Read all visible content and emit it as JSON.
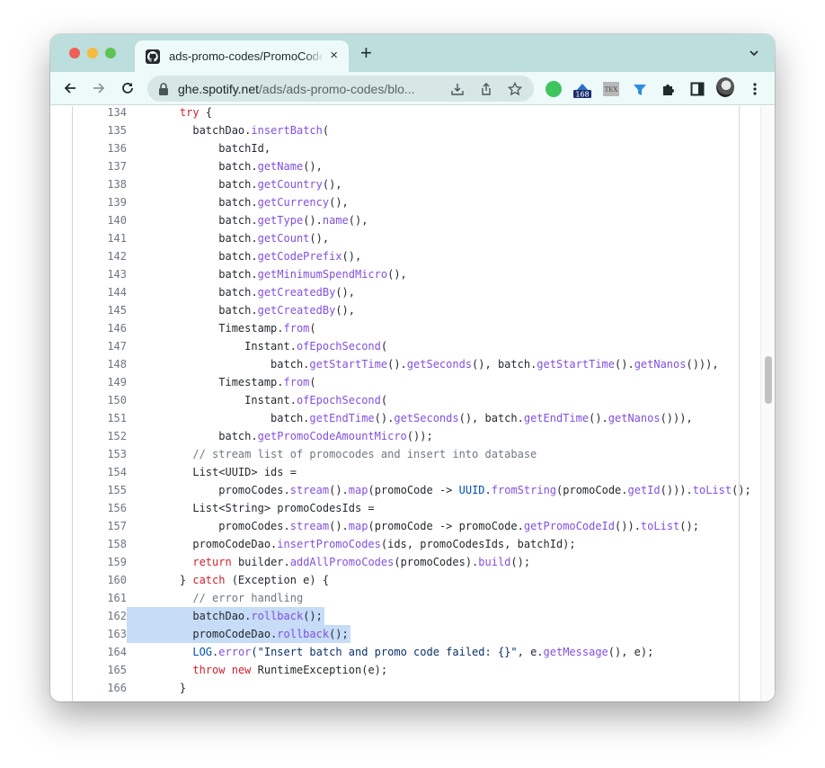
{
  "browser": {
    "tab_title": "ads-promo-codes/PromoCodeService.java",
    "tab_close": "×",
    "new_tab": "+",
    "url_host": "ghe.spotify.net",
    "url_path": "/ads/ads-promo-codes/blo...",
    "extension_badge": "168",
    "tex_label": "TEX"
  },
  "colors": {
    "tab_strip": "#bcdedc",
    "toolbar": "#eefafa",
    "keyword": "#cf222e",
    "function": "#8250df",
    "comment": "#6e7781",
    "selection": "#c6dcf7"
  },
  "code": {
    "lines": [
      {
        "n": "134",
        "indent": 2,
        "tokens": [
          [
            "k",
            "try"
          ],
          [
            "p",
            " {"
          ]
        ]
      },
      {
        "n": "135",
        "indent": 3,
        "tokens": [
          [
            "p",
            "batchDao."
          ],
          [
            "f",
            "insertBatch"
          ],
          [
            "p",
            "("
          ]
        ]
      },
      {
        "n": "136",
        "indent": 5,
        "tokens": [
          [
            "p",
            "batchId,"
          ]
        ]
      },
      {
        "n": "137",
        "indent": 5,
        "tokens": [
          [
            "p",
            "batch."
          ],
          [
            "f",
            "getName"
          ],
          [
            "p",
            "(),"
          ]
        ]
      },
      {
        "n": "138",
        "indent": 5,
        "tokens": [
          [
            "p",
            "batch."
          ],
          [
            "f",
            "getCountry"
          ],
          [
            "p",
            "(),"
          ]
        ]
      },
      {
        "n": "139",
        "indent": 5,
        "tokens": [
          [
            "p",
            "batch."
          ],
          [
            "f",
            "getCurrency"
          ],
          [
            "p",
            "(),"
          ]
        ]
      },
      {
        "n": "140",
        "indent": 5,
        "tokens": [
          [
            "p",
            "batch."
          ],
          [
            "f",
            "getType"
          ],
          [
            "p",
            "()."
          ],
          [
            "f",
            "name"
          ],
          [
            "p",
            "(),"
          ]
        ]
      },
      {
        "n": "141",
        "indent": 5,
        "tokens": [
          [
            "p",
            "batch."
          ],
          [
            "f",
            "getCount"
          ],
          [
            "p",
            "(),"
          ]
        ]
      },
      {
        "n": "142",
        "indent": 5,
        "tokens": [
          [
            "p",
            "batch."
          ],
          [
            "f",
            "getCodePrefix"
          ],
          [
            "p",
            "(),"
          ]
        ]
      },
      {
        "n": "143",
        "indent": 5,
        "tokens": [
          [
            "p",
            "batch."
          ],
          [
            "f",
            "getMinimumSpendMicro"
          ],
          [
            "p",
            "(),"
          ]
        ]
      },
      {
        "n": "144",
        "indent": 5,
        "tokens": [
          [
            "p",
            "batch."
          ],
          [
            "f",
            "getCreatedBy"
          ],
          [
            "p",
            "(),"
          ]
        ]
      },
      {
        "n": "145",
        "indent": 5,
        "tokens": [
          [
            "p",
            "batch."
          ],
          [
            "f",
            "getCreatedBy"
          ],
          [
            "p",
            "(),"
          ]
        ]
      },
      {
        "n": "146",
        "indent": 5,
        "tokens": [
          [
            "p",
            "Timestamp."
          ],
          [
            "f",
            "from"
          ],
          [
            "p",
            "("
          ]
        ]
      },
      {
        "n": "147",
        "indent": 7,
        "tokens": [
          [
            "p",
            "Instant."
          ],
          [
            "f",
            "ofEpochSecond"
          ],
          [
            "p",
            "("
          ]
        ]
      },
      {
        "n": "148",
        "indent": 9,
        "tokens": [
          [
            "p",
            "batch."
          ],
          [
            "f",
            "getStartTime"
          ],
          [
            "p",
            "()."
          ],
          [
            "f",
            "getSeconds"
          ],
          [
            "p",
            "(), batch."
          ],
          [
            "f",
            "getStartTime"
          ],
          [
            "p",
            "()."
          ],
          [
            "f",
            "getNanos"
          ],
          [
            "p",
            "())),"
          ]
        ]
      },
      {
        "n": "149",
        "indent": 5,
        "tokens": [
          [
            "p",
            "Timestamp."
          ],
          [
            "f",
            "from"
          ],
          [
            "p",
            "("
          ]
        ]
      },
      {
        "n": "150",
        "indent": 7,
        "tokens": [
          [
            "p",
            "Instant."
          ],
          [
            "f",
            "ofEpochSecond"
          ],
          [
            "p",
            "("
          ]
        ]
      },
      {
        "n": "151",
        "indent": 9,
        "tokens": [
          [
            "p",
            "batch."
          ],
          [
            "f",
            "getEndTime"
          ],
          [
            "p",
            "()."
          ],
          [
            "f",
            "getSeconds"
          ],
          [
            "p",
            "(), batch."
          ],
          [
            "f",
            "getEndTime"
          ],
          [
            "p",
            "()."
          ],
          [
            "f",
            "getNanos"
          ],
          [
            "p",
            "())),"
          ]
        ]
      },
      {
        "n": "152",
        "indent": 5,
        "tokens": [
          [
            "p",
            "batch."
          ],
          [
            "f",
            "getPromoCodeAmountMicro"
          ],
          [
            "p",
            "());"
          ]
        ]
      },
      {
        "n": "153",
        "indent": 3,
        "tokens": [
          [
            "c",
            "// stream list of promocodes and insert into database"
          ]
        ]
      },
      {
        "n": "154",
        "indent": 3,
        "tokens": [
          [
            "p",
            "List<UUID> ids ="
          ]
        ]
      },
      {
        "n": "155",
        "indent": 5,
        "tokens": [
          [
            "p",
            "promoCodes."
          ],
          [
            "f",
            "stream"
          ],
          [
            "p",
            "()."
          ],
          [
            "f",
            "map"
          ],
          [
            "p",
            "(promoCode -> "
          ],
          [
            "t",
            "UUID"
          ],
          [
            "p",
            "."
          ],
          [
            "f",
            "fromString"
          ],
          [
            "p",
            "(promoCode."
          ],
          [
            "f",
            "getId"
          ],
          [
            "p",
            "()))."
          ],
          [
            "f",
            "toList"
          ],
          [
            "p",
            "();"
          ]
        ]
      },
      {
        "n": "156",
        "indent": 3,
        "tokens": [
          [
            "p",
            "List<String> promoCodesIds ="
          ]
        ]
      },
      {
        "n": "157",
        "indent": 5,
        "tokens": [
          [
            "p",
            "promoCodes."
          ],
          [
            "f",
            "stream"
          ],
          [
            "p",
            "()."
          ],
          [
            "f",
            "map"
          ],
          [
            "p",
            "(promoCode -> promoCode."
          ],
          [
            "f",
            "getPromoCodeId"
          ],
          [
            "p",
            "())."
          ],
          [
            "f",
            "toList"
          ],
          [
            "p",
            "();"
          ]
        ]
      },
      {
        "n": "158",
        "indent": 3,
        "tokens": [
          [
            "p",
            "promoCodeDao."
          ],
          [
            "f",
            "insertPromoCodes"
          ],
          [
            "p",
            "(ids, promoCodesIds, batchId);"
          ]
        ]
      },
      {
        "n": "159",
        "indent": 3,
        "tokens": [
          [
            "k",
            "return"
          ],
          [
            "p",
            " builder."
          ],
          [
            "f",
            "addAllPromoCodes"
          ],
          [
            "p",
            "(promoCodes)."
          ],
          [
            "f",
            "build"
          ],
          [
            "p",
            "();"
          ]
        ]
      },
      {
        "n": "160",
        "indent": 2,
        "tokens": [
          [
            "p",
            "} "
          ],
          [
            "k",
            "catch"
          ],
          [
            "p",
            " (Exception e) {"
          ]
        ]
      },
      {
        "n": "161",
        "indent": 3,
        "tokens": [
          [
            "c",
            "// error handling"
          ]
        ]
      },
      {
        "n": "162",
        "indent": 3,
        "highlight": true,
        "tokens": [
          [
            "p",
            "batchDao."
          ],
          [
            "f",
            "rollback"
          ],
          [
            "p",
            "();"
          ]
        ]
      },
      {
        "n": "163",
        "indent": 3,
        "highlight": true,
        "tokens": [
          [
            "p",
            "promoCodeDao."
          ],
          [
            "f",
            "rollback"
          ],
          [
            "p",
            "();"
          ]
        ]
      },
      {
        "n": "164",
        "indent": 3,
        "tokens": [
          [
            "t",
            "LOG"
          ],
          [
            "p",
            "."
          ],
          [
            "f",
            "error"
          ],
          [
            "s",
            "(\"Insert batch and promo code failed: {}\""
          ],
          [
            "p",
            ", e."
          ],
          [
            "f",
            "getMessage"
          ],
          [
            "p",
            "(), e);"
          ]
        ]
      },
      {
        "n": "165",
        "indent": 3,
        "tokens": [
          [
            "k",
            "throw"
          ],
          [
            "p",
            " "
          ],
          [
            "k",
            "new"
          ],
          [
            "p",
            " RuntimeException(e);"
          ]
        ]
      },
      {
        "n": "166",
        "indent": 2,
        "tokens": [
          [
            "p",
            "}"
          ]
        ]
      }
    ]
  }
}
